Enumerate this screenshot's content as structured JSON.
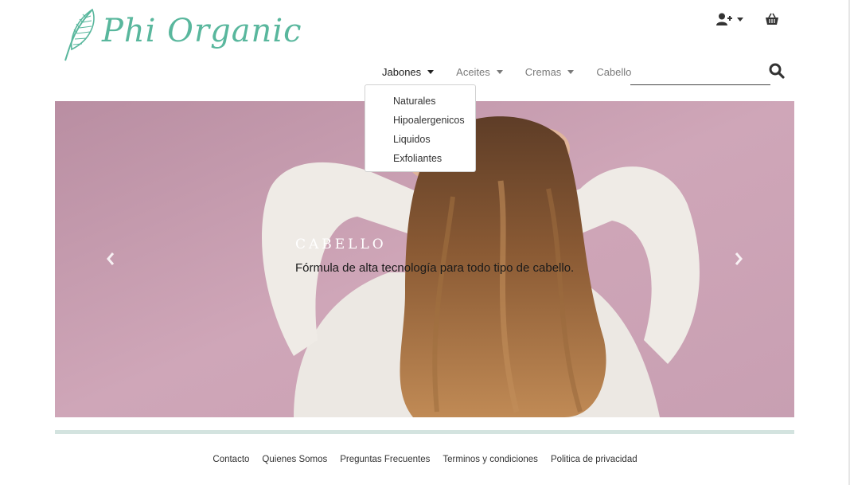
{
  "brand": {
    "logo_text": "Phi Organic",
    "color": "#59b79d"
  },
  "header": {
    "user_icon": "user-plus-icon",
    "cart_icon": "basket-icon"
  },
  "nav": {
    "items": [
      {
        "label": "Jabones",
        "has_dropdown": true,
        "active": true
      },
      {
        "label": "Aceites",
        "has_dropdown": true
      },
      {
        "label": "Cremas",
        "has_dropdown": true
      },
      {
        "label": "Cabello",
        "has_dropdown": false
      }
    ],
    "search": {
      "placeholder": "",
      "icon": "search-icon"
    }
  },
  "dropdown": {
    "items": [
      {
        "label": "Naturales"
      },
      {
        "label": "Hipoalergenicos"
      },
      {
        "label": "Liquidos"
      },
      {
        "label": "Exfoliantes"
      }
    ]
  },
  "carousel": {
    "caption_title": "CABELLO",
    "caption_text": "Fórmula de alta tecnología para todo tipo de cabello.",
    "prev_icon": "chevron-left-icon",
    "next_icon": "chevron-right-icon",
    "background_color": "#c79bad"
  },
  "footer": {
    "links": [
      {
        "label": "Contacto"
      },
      {
        "label": "Quienes Somos"
      },
      {
        "label": "Preguntas Frecuentes"
      },
      {
        "label": "Terminos y condiciones"
      },
      {
        "label": "Politica de privacidad"
      }
    ]
  }
}
